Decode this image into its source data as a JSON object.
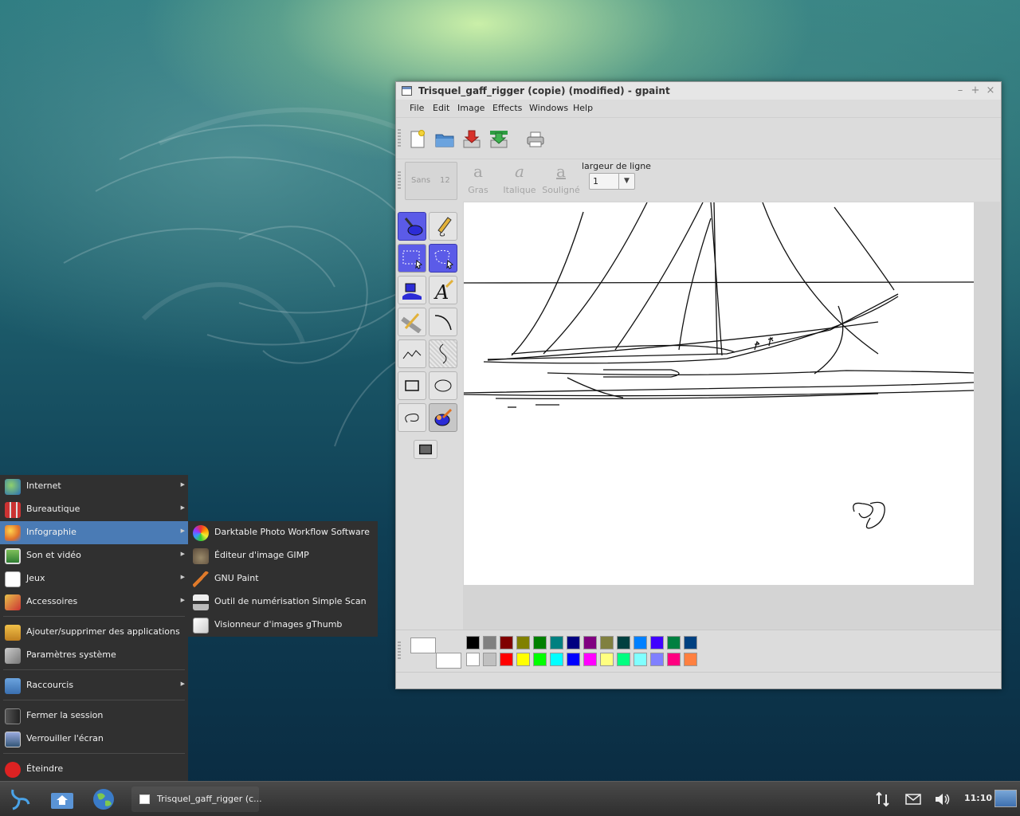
{
  "window": {
    "title": "Trisquel_gaff_rigger (copie) (modified) - gpaint",
    "minimize": "–",
    "maximize": "+",
    "close": "×"
  },
  "menubar": [
    "File",
    "Edit",
    "Image",
    "Effects",
    "Windows",
    "Help"
  ],
  "toolbar": {
    "buttons": [
      "new-icon",
      "open-icon",
      "save-icon",
      "save-as-icon",
      "print-icon"
    ]
  },
  "font_toolbar": {
    "font_name": "Sans",
    "font_size": "12",
    "bold": "Gras",
    "italic": "Italique",
    "underline": "Souligné",
    "line_width_label": "largeur de ligne",
    "line_width_value": "1"
  },
  "tools": [
    "paintbrush-icon",
    "pencil-icon",
    "rect-select-icon",
    "lasso-select-icon",
    "fill-icon",
    "text-icon",
    "line-icon",
    "curve-icon",
    "multiline-icon",
    "freeform-icon",
    "rectangle-icon",
    "oval-icon",
    "closed-freehand-icon",
    "eraser-icon",
    "fill-mode-icon"
  ],
  "palette": {
    "row1": [
      "#000000",
      "#808080",
      "#800000",
      "#808000",
      "#008000",
      "#008080",
      "#000080",
      "#800080",
      "#808040",
      "#004040",
      "#0080ff",
      "#4000ff",
      "#008040",
      "#004080"
    ],
    "row2": [
      "#ffffff",
      "#c0c0c0",
      "#ff0000",
      "#ffff00",
      "#00ff00",
      "#00ffff",
      "#0000ff",
      "#ff00ff",
      "#ffff80",
      "#00ff80",
      "#80ffff",
      "#8080ff",
      "#ff0080",
      "#ff8040"
    ]
  },
  "start_menu": {
    "items": [
      {
        "label": "Internet",
        "icon": "globe-icon",
        "has_submenu": true
      },
      {
        "label": "Bureautique",
        "icon": "office-icon",
        "has_submenu": true
      },
      {
        "label": "Infographie",
        "icon": "graphics-icon",
        "has_submenu": true,
        "highlighted": true
      },
      {
        "label": "Son et vidéo",
        "icon": "multimedia-icon",
        "has_submenu": true
      },
      {
        "label": "Jeux",
        "icon": "games-icon",
        "has_submenu": true
      },
      {
        "label": "Accessoires",
        "icon": "accessories-icon",
        "has_submenu": true
      },
      {
        "label": "Ajouter/supprimer des applications",
        "icon": "software-icon"
      },
      {
        "label": "Paramètres système",
        "icon": "settings-icon"
      },
      {
        "label": "Raccourcis",
        "icon": "folder-icon",
        "has_submenu": true
      },
      {
        "label": "Fermer la session",
        "icon": "logout-icon"
      },
      {
        "label": "Verrouiller l'écran",
        "icon": "lock-screen-icon"
      },
      {
        "label": "Éteindre",
        "icon": "power-icon"
      }
    ],
    "submenu": [
      {
        "label": "Darktable Photo Workflow Software",
        "icon": "darktable-icon"
      },
      {
        "label": "Éditeur d'image GIMP",
        "icon": "gimp-icon"
      },
      {
        "label": "GNU Paint",
        "icon": "gpaint-icon"
      },
      {
        "label": "Outil de numérisation Simple Scan",
        "icon": "scanner-icon"
      },
      {
        "label": "Visionneur d'images gThumb",
        "icon": "gthumb-icon"
      }
    ]
  },
  "taskbar": {
    "task_label": "Trisquel_gaff_rigger (c...",
    "clock": "11:10"
  }
}
